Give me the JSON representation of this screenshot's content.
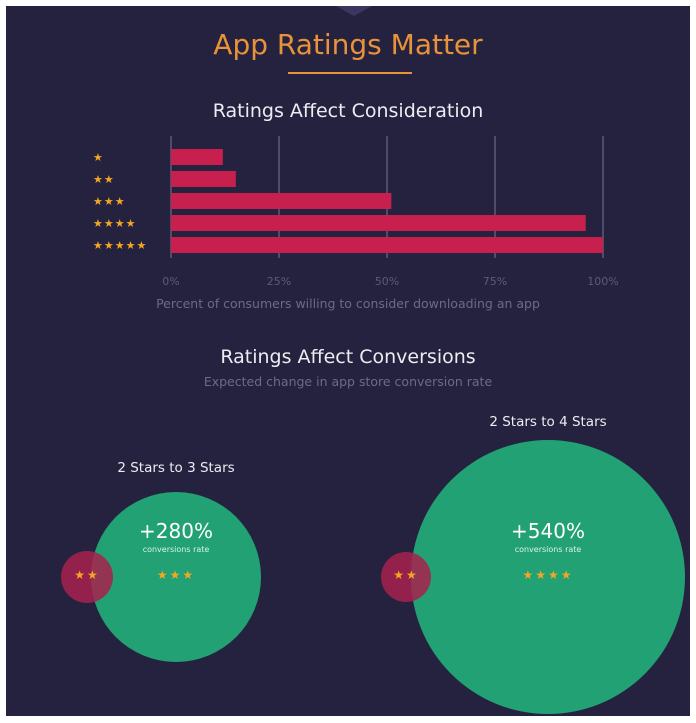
{
  "page": {
    "title": "App Ratings Matter"
  },
  "consideration": {
    "title": "Ratings Affect Consideration",
    "caption": "Percent of consumers willing to consider downloading an app"
  },
  "conversions": {
    "title": "Ratings Affect Conversions",
    "subtitle": "Expected change in app store conversion rate",
    "items": [
      {
        "label": "2 Stars to 3 Stars",
        "value": "+280%",
        "sublabel": "conversions rate",
        "from_stars": "★★",
        "to_stars": "★★★"
      },
      {
        "label": "2  Stars to 4 Stars",
        "value": "+540%",
        "sublabel": "conversions rate",
        "from_stars": "★★",
        "to_stars": "★★★★"
      }
    ]
  },
  "colors": {
    "background": "#25223f",
    "accent": "#e8923a",
    "bar": "#c8204e",
    "grid": "#6b6884",
    "green": "#22a175",
    "red_circle": "#a8214e"
  },
  "chart_data": [
    {
      "type": "bar",
      "orientation": "horizontal",
      "title": "Ratings Affect Consideration",
      "xlabel": "Percent of consumers willing to consider downloading an app",
      "categories": [
        "★",
        "★★",
        "★★★",
        "★★★★",
        "★★★★★"
      ],
      "values": [
        12,
        15,
        51,
        96,
        100
      ],
      "xticks": [
        "0%",
        "25%",
        "50%",
        "75%",
        "100%"
      ],
      "xlim": [
        0,
        100
      ],
      "grid": true
    },
    {
      "type": "bubble",
      "title": "Ratings Affect Conversions",
      "subtitle": "Expected change in app store conversion rate",
      "categories": [
        "2 Stars to 3 Stars",
        "2  Stars to 4 Stars"
      ],
      "values": [
        280,
        540
      ],
      "labels": [
        "+280%",
        "+540%"
      ]
    }
  ]
}
